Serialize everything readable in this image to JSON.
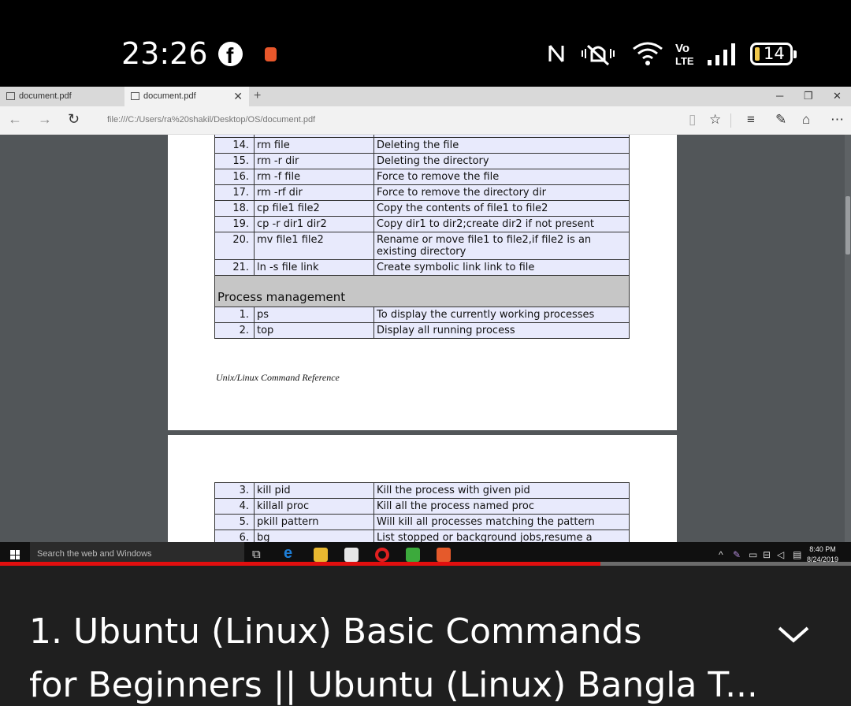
{
  "status_bar": {
    "time": "23:26",
    "battery_level": "14"
  },
  "browser": {
    "tabs": [
      {
        "label": "document.pdf"
      },
      {
        "label": "document.pdf"
      }
    ],
    "new_tab": "+",
    "url": "file:///C:/Users/ra%20shakil/Desktop/OS/document.pdf"
  },
  "pdf": {
    "rows_page1": [
      {
        "num": "14.",
        "cmd": "rm file",
        "desc": "Deleting the file"
      },
      {
        "num": "15.",
        "cmd": "rm -r dir",
        "desc": "Deleting the directory"
      },
      {
        "num": "16.",
        "cmd": "rm -f file",
        "desc": "Force to remove the file"
      },
      {
        "num": "17.",
        "cmd": "rm -rf dir",
        "desc": "Force to remove the directory dir"
      },
      {
        "num": "18.",
        "cmd": "cp file1 file2",
        "desc": "Copy the contents of file1 to file2"
      },
      {
        "num": "19.",
        "cmd": "cp -r dir1 dir2",
        "desc": "Copy dir1 to dir2;create dir2 if not present"
      },
      {
        "num": "20.",
        "cmd": "mv file1 file2",
        "desc": "Rename or move file1 to file2,if file2 is an existing directory"
      },
      {
        "num": "21.",
        "cmd": "ln -s file link",
        "desc": "Create symbolic link link to file"
      }
    ],
    "section_title": "Process management",
    "rows_section": [
      {
        "num": "1.",
        "cmd": "ps",
        "desc": "To display the currently working processes"
      },
      {
        "num": "2.",
        "cmd": "top",
        "desc": "Display all running process"
      }
    ],
    "footer": "Unix/Linux Command Reference",
    "rows_page2": [
      {
        "num": "3.",
        "cmd": "kill pid",
        "desc": "Kill the process with given pid"
      },
      {
        "num": "4.",
        "cmd": "killall proc",
        "desc": "Kill all the process named proc"
      },
      {
        "num": "5.",
        "cmd": "pkill pattern",
        "desc": "Will kill all processes matching the pattern"
      },
      {
        "num": "6.",
        "cmd": "bg",
        "desc": "List stopped or background jobs,resume a stopped"
      }
    ]
  },
  "taskbar": {
    "search_placeholder": "Search the web and Windows",
    "time": "8:40 PM",
    "date": "8/24/2019"
  },
  "video": {
    "progress_fraction": 0.706,
    "title_line1": "1. Ubuntu (Linux) Basic Commands",
    "title_line2": "for Beginners || Ubuntu (Linux) Bangla T..."
  }
}
